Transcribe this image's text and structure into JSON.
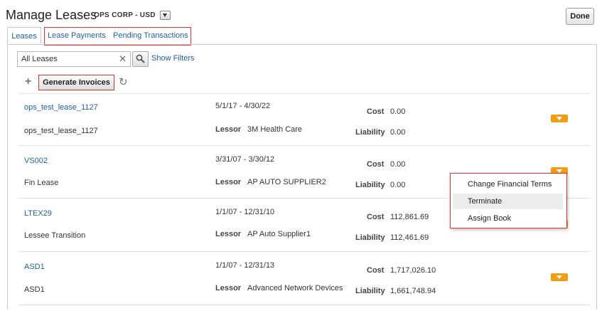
{
  "header": {
    "title": "Manage Leases",
    "org": "OPS CORP - USD",
    "done_label": "Done"
  },
  "tabs": [
    {
      "label": "Leases",
      "active": true
    },
    {
      "label": "Lease Payments",
      "active": false
    },
    {
      "label": "Pending Transactions",
      "active": false
    }
  ],
  "search": {
    "value": "All Leases",
    "clear": "✕",
    "show_filters": "Show Filters"
  },
  "toolbar": {
    "add": "+",
    "generate_invoices": "Generate Invoices",
    "refresh": "↻"
  },
  "labels": {
    "cost": "Cost",
    "liability": "Liability",
    "lessor": "Lessor"
  },
  "leases": [
    {
      "number": "ops_test_lease_1127",
      "description": "ops_test_lease_1127",
      "dates": "5/1/17 - 4/30/22",
      "lessor": "3M Health Care",
      "cost": "0.00",
      "liability": "0.00"
    },
    {
      "number": "VS002",
      "description": "Fin Lease",
      "dates": "3/31/07 - 3/30/12",
      "lessor": "AP AUTO SUPPLIER2",
      "cost": "0.00",
      "liability": "0.00"
    },
    {
      "number": "LTEX29",
      "description": "Lessee Transition",
      "dates": "1/1/07 - 12/31/10",
      "lessor": "AP Auto Supplier1",
      "cost": "112,861.69",
      "liability": "112,461.69"
    },
    {
      "number": "ASD1",
      "description": "ASD1",
      "dates": "1/1/07 - 12/31/13",
      "lessor": "Advanced Network Devices",
      "cost": "1,717,026.10",
      "liability": "1,661,748.94"
    }
  ],
  "actions_menu": {
    "items": [
      {
        "label": "Change Financial Terms",
        "highlighted": false
      },
      {
        "label": "Terminate",
        "highlighted": true
      },
      {
        "label": "Assign Book",
        "highlighted": false
      }
    ]
  },
  "colors": {
    "accent_link": "#1f5f9a",
    "action_button": "#f39c12",
    "highlight_border": "#dd3333"
  }
}
